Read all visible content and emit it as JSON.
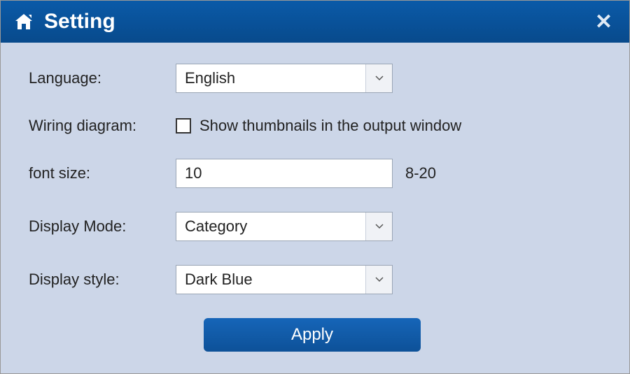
{
  "titlebar": {
    "title": "Setting"
  },
  "form": {
    "language": {
      "label": "Language:",
      "value": "English"
    },
    "wiring_diagram": {
      "label": "Wiring diagram:",
      "checkbox_label": "Show thumbnails in the output window",
      "checked": false
    },
    "font_size": {
      "label": "font size:",
      "value": "10",
      "hint": "8-20"
    },
    "display_mode": {
      "label": "Display Mode:",
      "value": "Category"
    },
    "display_style": {
      "label": "Display style:",
      "value": "Dark Blue"
    }
  },
  "actions": {
    "apply_label": "Apply"
  }
}
